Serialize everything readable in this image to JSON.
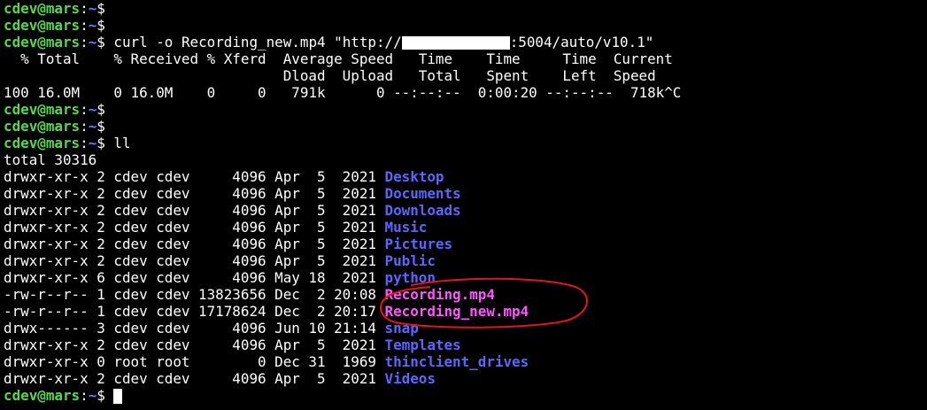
{
  "prompt": {
    "user_host": "cdev@mars",
    "sep": ":",
    "path": "~",
    "symbol": "$ "
  },
  "lines": [
    {
      "kind": "prompt",
      "cmd": ""
    },
    {
      "kind": "prompt",
      "cmd": ""
    },
    {
      "kind": "curl",
      "cmd_pre": "curl -o Recording_new.mp4 \"http://",
      "cmd_post": ":5004/auto/v10.1\""
    },
    {
      "kind": "text",
      "text": "  % Total    % Received % Xferd  Average Speed   Time    Time     Time  Current"
    },
    {
      "kind": "text",
      "text": "                                 Dload  Upload   Total   Spent    Left  Speed"
    },
    {
      "kind": "text",
      "text": "100 16.0M    0 16.0M    0     0   791k      0 --:--:--  0:00:20 --:--:--  718k^C"
    },
    {
      "kind": "prompt",
      "cmd": ""
    },
    {
      "kind": "prompt",
      "cmd": ""
    },
    {
      "kind": "prompt",
      "cmd": "ll"
    },
    {
      "kind": "text",
      "text": "total 30316"
    },
    {
      "kind": "entry",
      "meta": "drwxr-xr-x 2 cdev cdev     4096 Apr  5  2021 ",
      "name": "Desktop",
      "type": "dir"
    },
    {
      "kind": "entry",
      "meta": "drwxr-xr-x 2 cdev cdev     4096 Apr  5  2021 ",
      "name": "Documents",
      "type": "dir"
    },
    {
      "kind": "entry",
      "meta": "drwxr-xr-x 2 cdev cdev     4096 Apr  5  2021 ",
      "name": "Downloads",
      "type": "dir"
    },
    {
      "kind": "entry",
      "meta": "drwxr-xr-x 2 cdev cdev     4096 Apr  5  2021 ",
      "name": "Music",
      "type": "dir"
    },
    {
      "kind": "entry",
      "meta": "drwxr-xr-x 2 cdev cdev     4096 Apr  5  2021 ",
      "name": "Pictures",
      "type": "dir"
    },
    {
      "kind": "entry",
      "meta": "drwxr-xr-x 2 cdev cdev     4096 Apr  5  2021 ",
      "name": "Public",
      "type": "dir"
    },
    {
      "kind": "entry",
      "meta": "drwxr-xr-x 6 cdev cdev     4096 May 18  2021 ",
      "name": "python",
      "type": "dir"
    },
    {
      "kind": "entry",
      "meta": "-rw-r--r-- 1 cdev cdev 13823656 Dec  2 20:08 ",
      "name": "Recording.mp4",
      "type": "media"
    },
    {
      "kind": "entry",
      "meta": "-rw-r--r-- 1 cdev cdev 17178624 Dec  2 20:17 ",
      "name": "Recording_new.mp4",
      "type": "media"
    },
    {
      "kind": "entry",
      "meta": "drwx------ 3 cdev cdev     4096 Jun 10 21:14 ",
      "name": "snap",
      "type": "dir"
    },
    {
      "kind": "entry",
      "meta": "drwxr-xr-x 2 cdev cdev     4096 Apr  5  2021 ",
      "name": "Templates",
      "type": "dir"
    },
    {
      "kind": "entry",
      "meta": "drwxr-xr-x 0 root root        0 Dec 31  1969 ",
      "name": "thinclient_drives",
      "type": "dir"
    },
    {
      "kind": "entry",
      "meta": "drwxr-xr-x 2 cdev cdev     4096 Apr  5  2021 ",
      "name": "Videos",
      "type": "dir"
    },
    {
      "kind": "prompt_cursor",
      "cmd": ""
    }
  ],
  "colors": {
    "background": "#000000",
    "prompt_user": "#55d84a",
    "prompt_path": "#6b7bff",
    "directory": "#5a66ff",
    "media_file": "#ff55ff",
    "annotation": "#e0161c"
  }
}
